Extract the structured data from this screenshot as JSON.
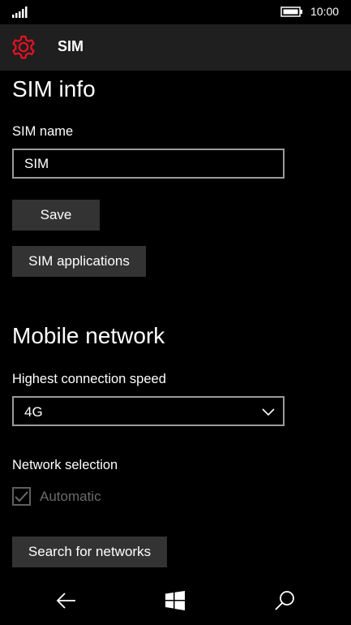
{
  "status_bar": {
    "signal_icon": "signal-strength-icon",
    "battery_icon": "battery-icon",
    "time": "10:00"
  },
  "title_bar": {
    "icon": "gear-icon",
    "accent_color": "#e81123",
    "title": "SIM"
  },
  "sim_info": {
    "section_title": "SIM info",
    "name_label": "SIM name",
    "name_value": "SIM",
    "save_button": "Save",
    "applications_button": "SIM applications"
  },
  "mobile_network": {
    "section_title": "Mobile network",
    "speed_label": "Highest connection speed",
    "speed_value": "4G",
    "network_selection_label": "Network selection",
    "automatic_label": "Automatic",
    "automatic_checked": true,
    "search_button": "Search for networks"
  },
  "nav_bar": {
    "back_icon": "back-arrow-icon",
    "start_icon": "windows-logo-icon",
    "search_icon": "search-icon"
  }
}
